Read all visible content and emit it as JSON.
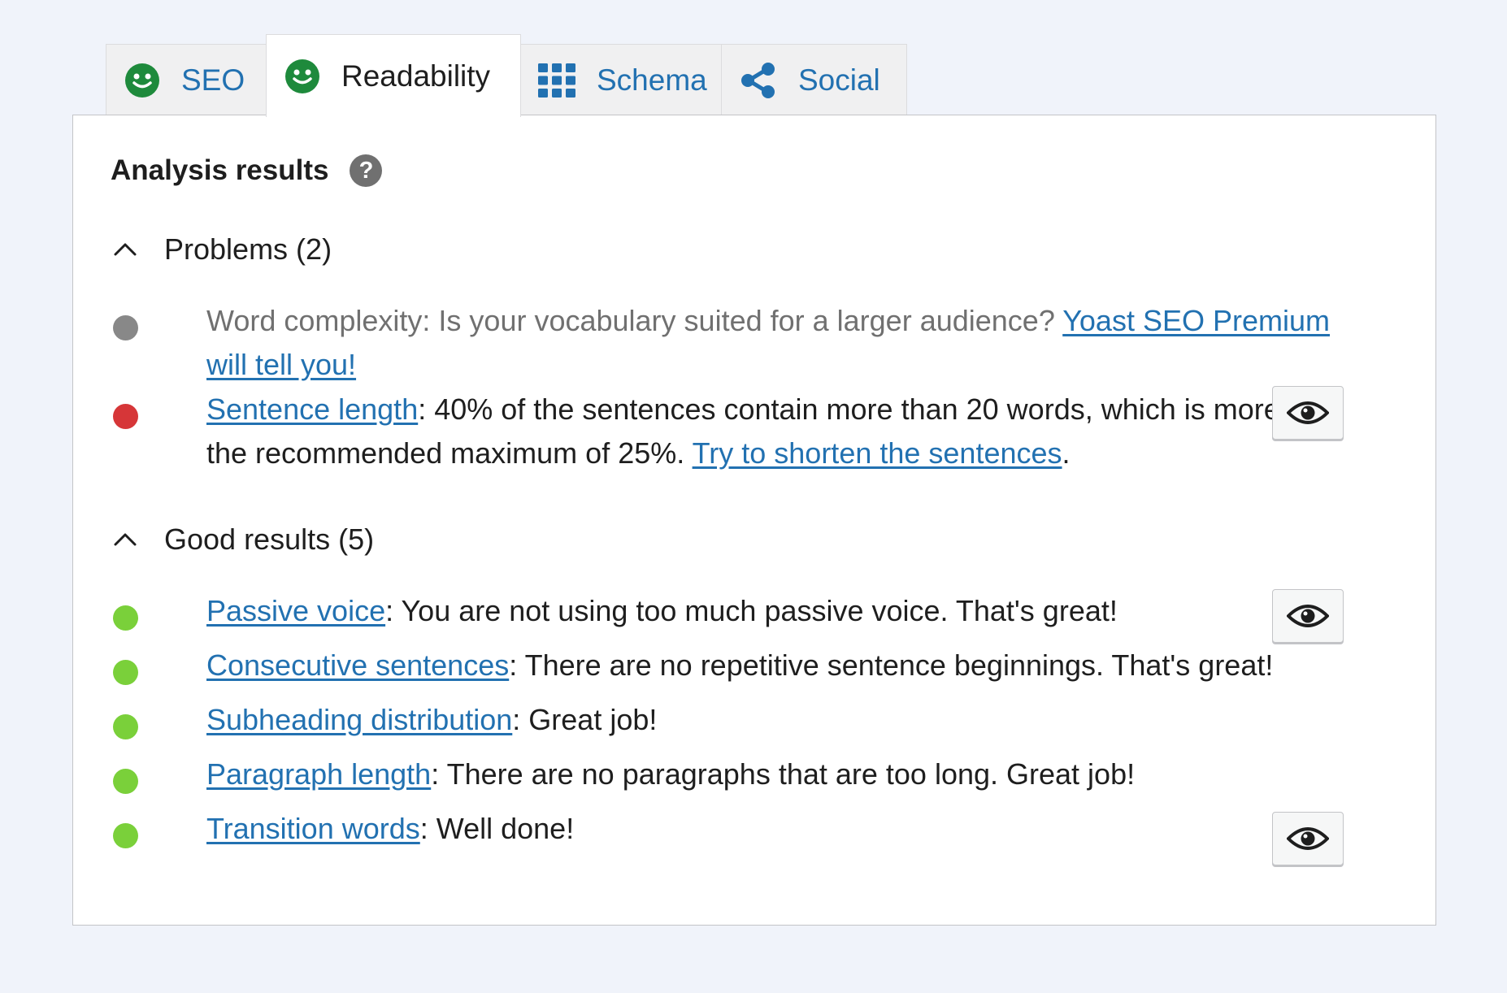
{
  "tabs": [
    {
      "label": "SEO",
      "icon": "smiley-face-icon",
      "icon_color": "#1e8a3c"
    },
    {
      "label": "Readability",
      "icon": "smiley-face-icon",
      "icon_color": "#1e8a3c",
      "active": true
    },
    {
      "label": "Schema",
      "icon": "grid-icon",
      "icon_color": "#2271b1"
    },
    {
      "label": "Social",
      "icon": "share-icon",
      "icon_color": "#2271b1"
    }
  ],
  "panel": {
    "title": "Analysis results",
    "help_icon": "help-icon",
    "problems": {
      "label": "Problems (2)",
      "items": [
        {
          "status": "gray",
          "status_color": "#888888",
          "text": "Word complexity: Is your vocabulary suited for a larger audience? ",
          "link": "Yoast SEO Premium will tell you!"
        },
        {
          "status": "red",
          "status_color": "#d63638",
          "link": "Sentence length",
          "text": ": 40% of the sentences contain more than 20 words, which is more than the recommended maximum of 25%. ",
          "link2": "Try to shorten the sentences",
          "suffix": ".",
          "has_eye": true
        }
      ]
    },
    "good": {
      "label": "Good results (5)",
      "items": [
        {
          "status": "green",
          "status_color": "#7ad03a",
          "link": "Passive voice",
          "text": ": You are not using too much passive voice. That's great!",
          "has_eye": true
        },
        {
          "status": "green",
          "status_color": "#7ad03a",
          "link": "Consecutive sentences",
          "text": ": There are no repetitive sentence beginnings. That's great!"
        },
        {
          "status": "green",
          "status_color": "#7ad03a",
          "link": "Subheading distribution",
          "text": ": Great job!"
        },
        {
          "status": "green",
          "status_color": "#7ad03a",
          "link": "Paragraph length",
          "text": ": There are no paragraphs that are too long. Great job!"
        },
        {
          "status": "green",
          "status_color": "#7ad03a",
          "link": "Transition words",
          "text": ": Well done!",
          "has_eye": true
        }
      ]
    }
  },
  "colors": {
    "link": "#2271b1",
    "background": "#f0f3fa"
  }
}
